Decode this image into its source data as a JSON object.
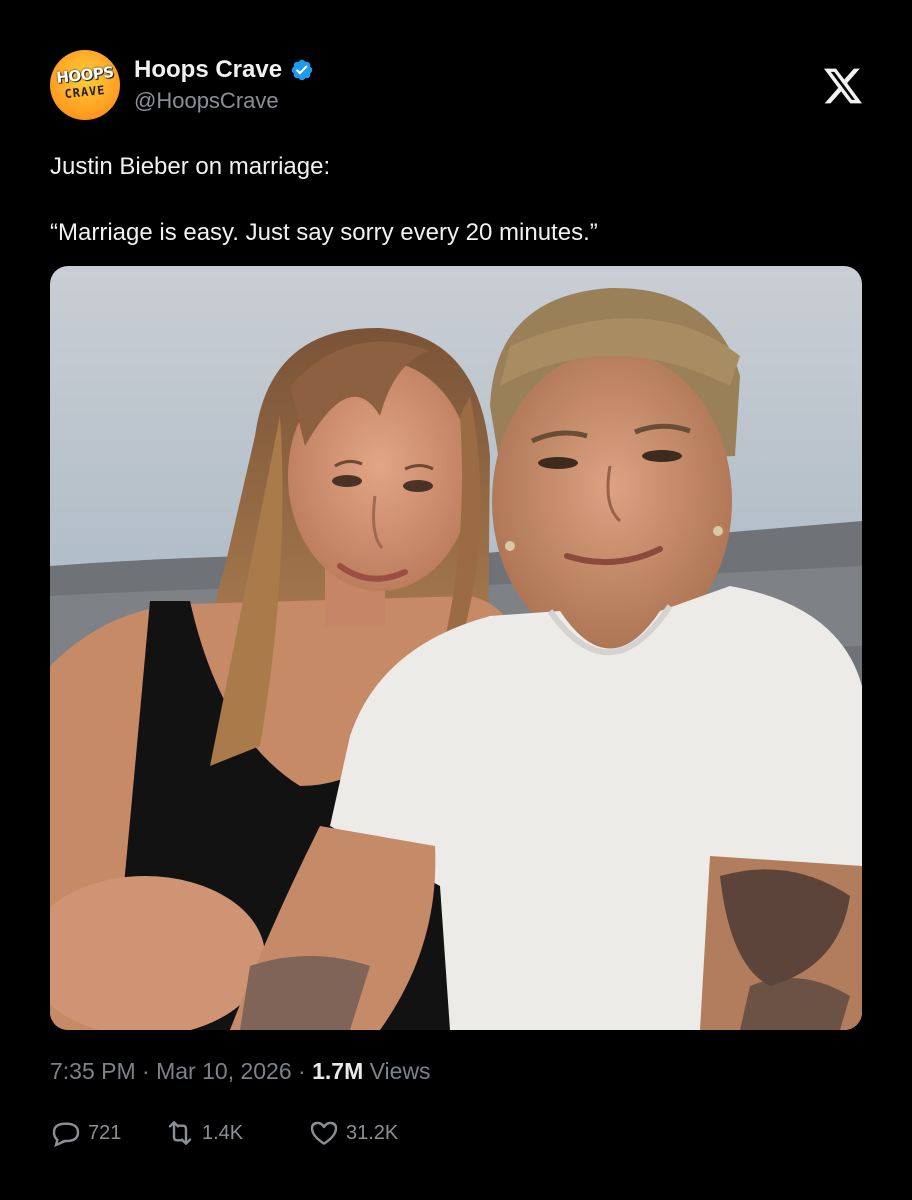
{
  "account": {
    "display_name": "Hoops Crave",
    "handle": "@HoopsCrave",
    "avatar_text_top": "HOOPS",
    "avatar_text_bottom": "CRAVE",
    "verified": true
  },
  "platform_icon": "x-logo-icon",
  "tweet": {
    "line1": "Justin Bieber on marriage:",
    "line2": "“Marriage is easy. Just say sorry every 20 minutes.”"
  },
  "media": {
    "kind": "photo"
  },
  "meta": {
    "time": "7:35 PM",
    "separator": "·",
    "date": "Mar 10, 2026",
    "views_count": "1.7M",
    "views_label": "Views"
  },
  "actions": {
    "replies": "721",
    "reposts": "1.4K",
    "likes": "31.2K"
  },
  "colors": {
    "background": "#000000",
    "text": "#e7e9ea",
    "muted": "#7d8288",
    "verified_blue": "#1d9bf0",
    "avatar_orange": "#ff9a1f"
  }
}
